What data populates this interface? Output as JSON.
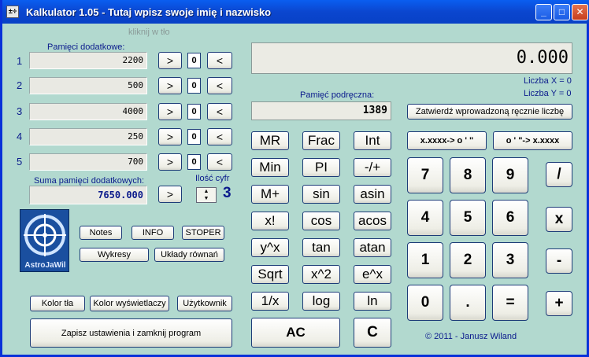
{
  "window": {
    "title": "Kalkulator 1.05 - Tutaj wpisz swoje imię i nazwisko",
    "icon": "calculator-icon",
    "controls": {
      "minimize": "_",
      "maximize": "□",
      "close": "✕"
    }
  },
  "hint": "kliknij w tło",
  "memories": {
    "heading": "Pamięci dodatkowe:",
    "rows": [
      {
        "index": "1",
        "value": "2200",
        "in": ">",
        "count": "0",
        "out": "<"
      },
      {
        "index": "2",
        "value": "500",
        "in": ">",
        "count": "0",
        "out": "<"
      },
      {
        "index": "3",
        "value": "4000",
        "in": ">",
        "count": "0",
        "out": "<"
      },
      {
        "index": "4",
        "value": "250",
        "in": ">",
        "count": "0",
        "out": "<"
      },
      {
        "index": "5",
        "value": "700",
        "in": ">",
        "count": "0",
        "out": "<"
      }
    ],
    "sum_label": "Suma pamięci dodatkowych:",
    "sum_value": "7650.000",
    "sum_button": ">",
    "digits_label": "Ilość cyfr",
    "digits_value": "3"
  },
  "logo": {
    "text": "AstroJaWil"
  },
  "buttons": {
    "notes": "Notes",
    "info": "INFO",
    "stoper": "STOPER",
    "wykresy": "Wykresy",
    "uklady": "Układy równań",
    "kolor_tla": "Kolor tła",
    "kolor_wysw": "Kolor wyświetlaczy",
    "uzytkownik": "Użytkownik",
    "zapisz": "Zapisz ustawienia i zamknij program"
  },
  "display": {
    "value": "0.000",
    "x_label": "Liczba X = 0",
    "y_label": "Liczba Y = 0"
  },
  "cache": {
    "label": "Pamięć podręczna:",
    "value": "1389",
    "confirm": "Zatwierdź wprowadzoną ręcznie liczbę"
  },
  "convert": {
    "to_dms": "x.xxxx-> o ' \"",
    "to_dec": "o ' \"-> x.xxxx"
  },
  "functions": [
    [
      "MR",
      "Frac",
      "Int"
    ],
    [
      "Min",
      "PI",
      "-/+"
    ],
    [
      "M+",
      "sin",
      "asin"
    ],
    [
      "x!",
      "cos",
      "acos"
    ],
    [
      "y^x",
      "tan",
      "atan"
    ],
    [
      "Sqrt",
      "x^2",
      "e^x"
    ],
    [
      "1/x",
      "log",
      "ln"
    ]
  ],
  "keypad": [
    [
      "7",
      "8",
      "9"
    ],
    [
      "4",
      "5",
      "6"
    ],
    [
      "1",
      "2",
      "3"
    ],
    [
      "0",
      ".",
      "="
    ]
  ],
  "operators": [
    "/",
    "x",
    "-",
    "+"
  ],
  "ac": "AC",
  "c": "C",
  "copyright": "© 2011 - Janusz Wiland"
}
